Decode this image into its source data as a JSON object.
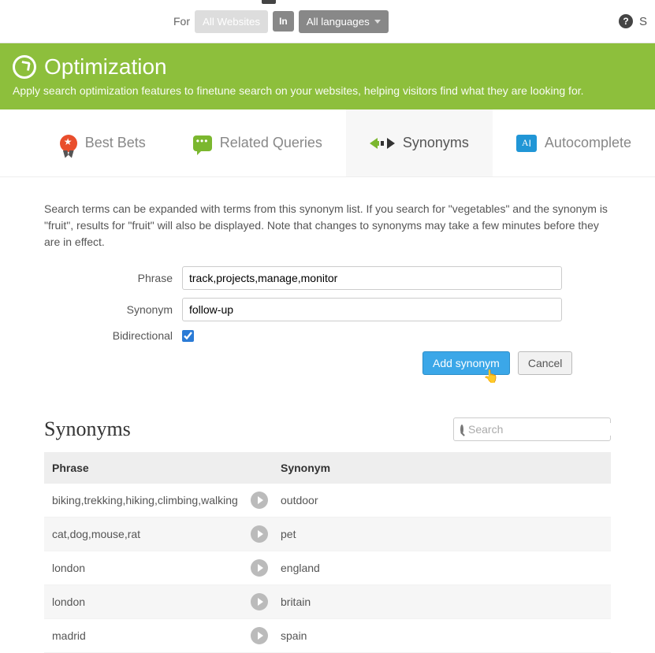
{
  "topbar": {
    "for_label": "For",
    "all_websites": "All Websites",
    "lang_abbrev": "In",
    "all_languages": "All languages",
    "help_letter": "S"
  },
  "header": {
    "title": "Optimization",
    "subtitle": "Apply search optimization features to finetune search on your websites, helping visitors find what they are looking for."
  },
  "tabs": {
    "best_bets": "Best Bets",
    "related": "Related Queries",
    "synonyms": "Synonyms",
    "autocomplete": "Autocomplete"
  },
  "content": {
    "intro": "Search terms can be expanded with terms from this synonym list. If you search for \"vegetables\" and the synonym is \"fruit\", results for \"fruit\" will also be displayed. Note that changes to synonyms may take a few minutes before they are in effect.",
    "form": {
      "phrase_label": "Phrase",
      "phrase_value": "track,projects,manage,monitor",
      "synonym_label": "Synonym",
      "synonym_value": "follow-up",
      "bidir_label": "Bidirectional"
    },
    "buttons": {
      "add": "Add synonym",
      "cancel": "Cancel"
    }
  },
  "list": {
    "title": "Synonyms",
    "search_placeholder": "Search",
    "columns": {
      "phrase": "Phrase",
      "synonym": "Synonym"
    },
    "rows": [
      {
        "phrase": "biking,trekking,hiking,climbing,walking",
        "synonym": "outdoor"
      },
      {
        "phrase": "cat,dog,mouse,rat",
        "synonym": "pet"
      },
      {
        "phrase": "london",
        "synonym": "england"
      },
      {
        "phrase": "london",
        "synonym": "britain"
      },
      {
        "phrase": "madrid",
        "synonym": "spain"
      }
    ]
  }
}
